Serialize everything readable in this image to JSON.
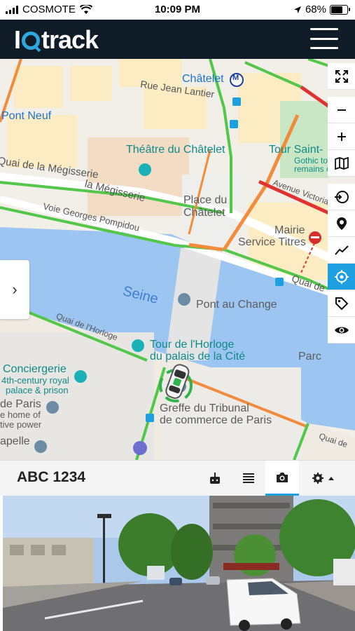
{
  "status_bar": {
    "carrier": "COSMOTE",
    "time": "10:09 PM",
    "battery": "68%"
  },
  "app": {
    "logo_text_1": "I",
    "logo_text_2": "track"
  },
  "map": {
    "labels": {
      "chatelet_station": "Châtelet",
      "metro_badge": "M",
      "rue_jean_lantier": "Rue Jean Lantier",
      "pont_neuf": "Pont Neuf",
      "theatre": "Théâtre du Châtelet",
      "tour_saint": "Tour Saint-",
      "gothic": "Gothic tower,",
      "remains": "remains of ch",
      "quai_megisserie": "la Mégisserie",
      "quai_megisserie_prefix": "Quai de la Mégisserie",
      "voie_georges": "Voie Georges Pompidou",
      "place_chatelet_1": "Place du",
      "place_chatelet_2": "Châtelet",
      "avenue_victoria": "Avenue Victoria",
      "mairie_1": "Mairie",
      "mairie_2": "Service Titres",
      "quai_de": "Quai de",
      "seine": "Seine",
      "pont_au_change": "Pont au Change",
      "quai_horloge": "Quai de l'Horloge",
      "tour_horloge_1": "Tour de l'Horloge",
      "tour_horloge_2": "du palais de la Cité",
      "conciergerie_1": "Conciergerie",
      "conciergerie_2": "4th-century royal",
      "conciergerie_3": "palace & prison",
      "de_paris": "de Paris",
      "home_of": "e home of",
      "tive_power": "tive power",
      "greffe_1": "Greffe du Tribunal",
      "greffe_2": "de commerce de Paris",
      "parc": "Parc",
      "pelle": "apelle",
      "on": "on",
      "quai_right": "Quai de"
    }
  },
  "device": {
    "plate": "ABC 1234"
  },
  "colors": {
    "accent": "#1e9fe0",
    "appbar": "#0f1b26",
    "traffic_green": "#52c74a",
    "traffic_orange": "#f28c3c",
    "traffic_red": "#e0332f"
  }
}
